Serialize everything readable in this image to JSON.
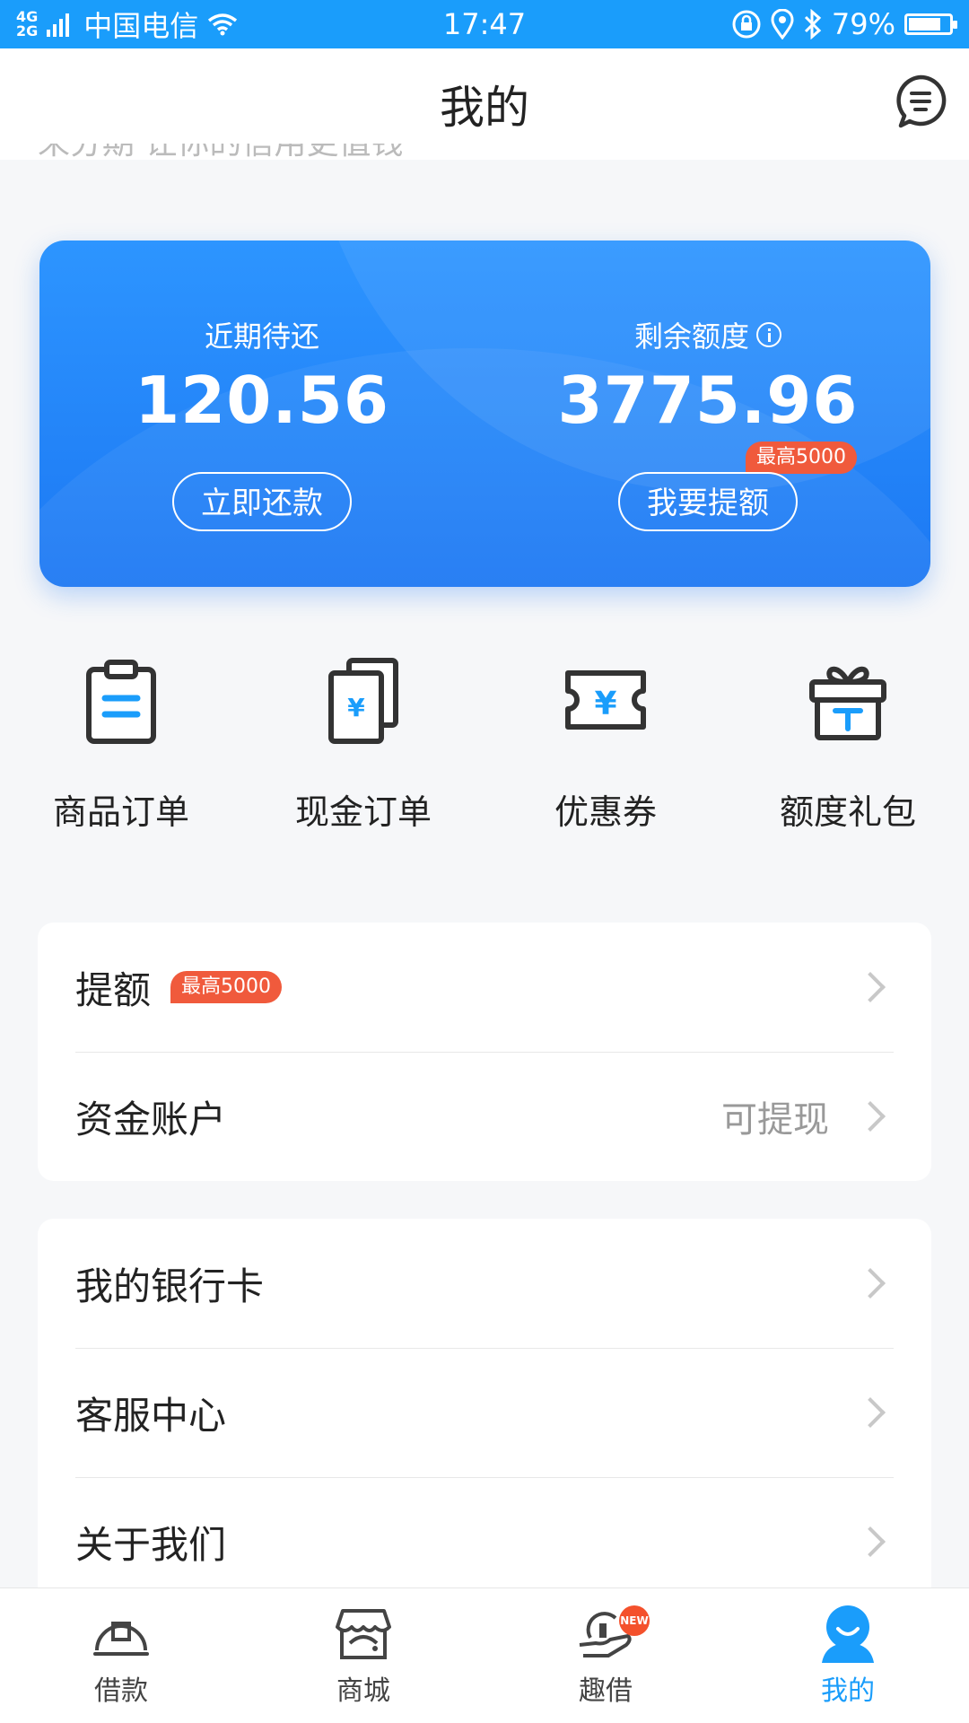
{
  "status_bar": {
    "network_top": "4G",
    "network_bottom": "2G",
    "carrier": "中国电信",
    "time": "17:47",
    "battery_percent_text": "79%",
    "battery_level": 0.79
  },
  "header": {
    "title": "我的"
  },
  "slogan": "来分期 让你的信用更值钱",
  "card": {
    "due_label": "近期待还",
    "due_value": "120.56",
    "repay_button": "立即还款",
    "limit_label": "剩余额度",
    "limit_value": "3775.96",
    "raise_badge": "最高5000",
    "raise_button": "我要提额"
  },
  "quick_actions": [
    {
      "label": "商品订单",
      "icon": "clipboard-icon"
    },
    {
      "label": "现金订单",
      "icon": "cash-docs-icon"
    },
    {
      "label": "优惠券",
      "icon": "coupon-icon"
    },
    {
      "label": "额度礼包",
      "icon": "gift-icon"
    }
  ],
  "menu_group_1": [
    {
      "label": "提额",
      "badge": "最高5000",
      "value": ""
    },
    {
      "label": "资金账户",
      "badge": "",
      "value": "可提现"
    }
  ],
  "menu_group_2": [
    {
      "label": "我的银行卡"
    },
    {
      "label": "客服中心"
    },
    {
      "label": "关于我们"
    }
  ],
  "bottom_nav": [
    {
      "label": "借款",
      "icon": "loan-icon"
    },
    {
      "label": "商城",
      "icon": "store-icon"
    },
    {
      "label": "趣借",
      "icon": "qujie-icon",
      "badge": "NEW"
    },
    {
      "label": "我的",
      "icon": "profile-icon",
      "active": true
    }
  ],
  "colors": {
    "accent": "#1a9dfb",
    "card_blue": "#1c78f3",
    "badge_red": "#f05a3c",
    "icon_dark": "#333333"
  }
}
